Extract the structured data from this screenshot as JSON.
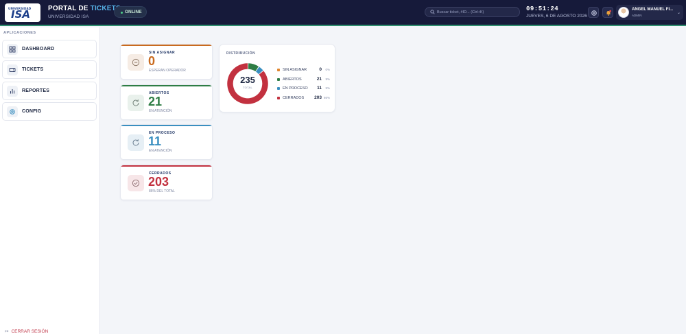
{
  "header": {
    "logo_small": "UNIVERSIDAD",
    "logo_big": "ISA",
    "title_prefix": "PORTAL DE",
    "title_accent": "TICKETS",
    "subtitle": "UNIVERSIDAD ISA",
    "status": "ONLINE",
    "search_placeholder": "Buscar ticket, #ID... (Ctrl+K)",
    "time": "09:51:24",
    "date": "JUEVES, 6 DE AGOSTO 2026",
    "user_name": "ANGEL MANUEL FI...",
    "user_role": "ADMIN",
    "colors": {
      "bg": "#161a3a",
      "accent": "#57b4e8"
    }
  },
  "sidebar": {
    "section_label": "APLICACIONES",
    "items": [
      {
        "label": "DASHBOARD",
        "icon": "grid-icon"
      },
      {
        "label": "TICKETS",
        "icon": "ticket-icon"
      },
      {
        "label": "REPORTES",
        "icon": "bar-chart-icon"
      },
      {
        "label": "CONFIG",
        "icon": "gear-icon"
      }
    ],
    "logout": "CERRAR SESIÓN"
  },
  "stats": [
    {
      "label": "SIN ASIGNAR",
      "value": "0",
      "hint": "ESPERAN OPERADOR",
      "color": "#c96a1e",
      "icon": "minus-circle-icon"
    },
    {
      "label": "ABIERTOS",
      "value": "21",
      "hint": "EN ATENCIÓN",
      "color": "#2e7d45",
      "icon": "refresh-icon"
    },
    {
      "label": "EN PROCESO",
      "value": "11",
      "hint": "EN ATENCIÓN",
      "color": "#3a8fc0",
      "icon": "refresh-icon"
    },
    {
      "label": "CERRADOS",
      "value": "203",
      "hint": "86% DEL TOTAL",
      "color": "#c2313f",
      "icon": "check-circle-icon"
    }
  ],
  "distribution": {
    "title": "DISTRIBUCIÓN",
    "total": "235",
    "total_caption": "TOTAL",
    "legend": [
      {
        "name": "SIN ASIGNAR",
        "count": "0",
        "pct": "0%",
        "color": "#e0862e"
      },
      {
        "name": "ABIERTOS",
        "count": "21",
        "pct": "9%",
        "color": "#2e7d45"
      },
      {
        "name": "EN PROCESO",
        "count": "11",
        "pct": "5%",
        "color": "#3a8fc0"
      },
      {
        "name": "CERRADOS",
        "count": "203",
        "pct": "86%",
        "color": "#c2313f"
      }
    ]
  }
}
